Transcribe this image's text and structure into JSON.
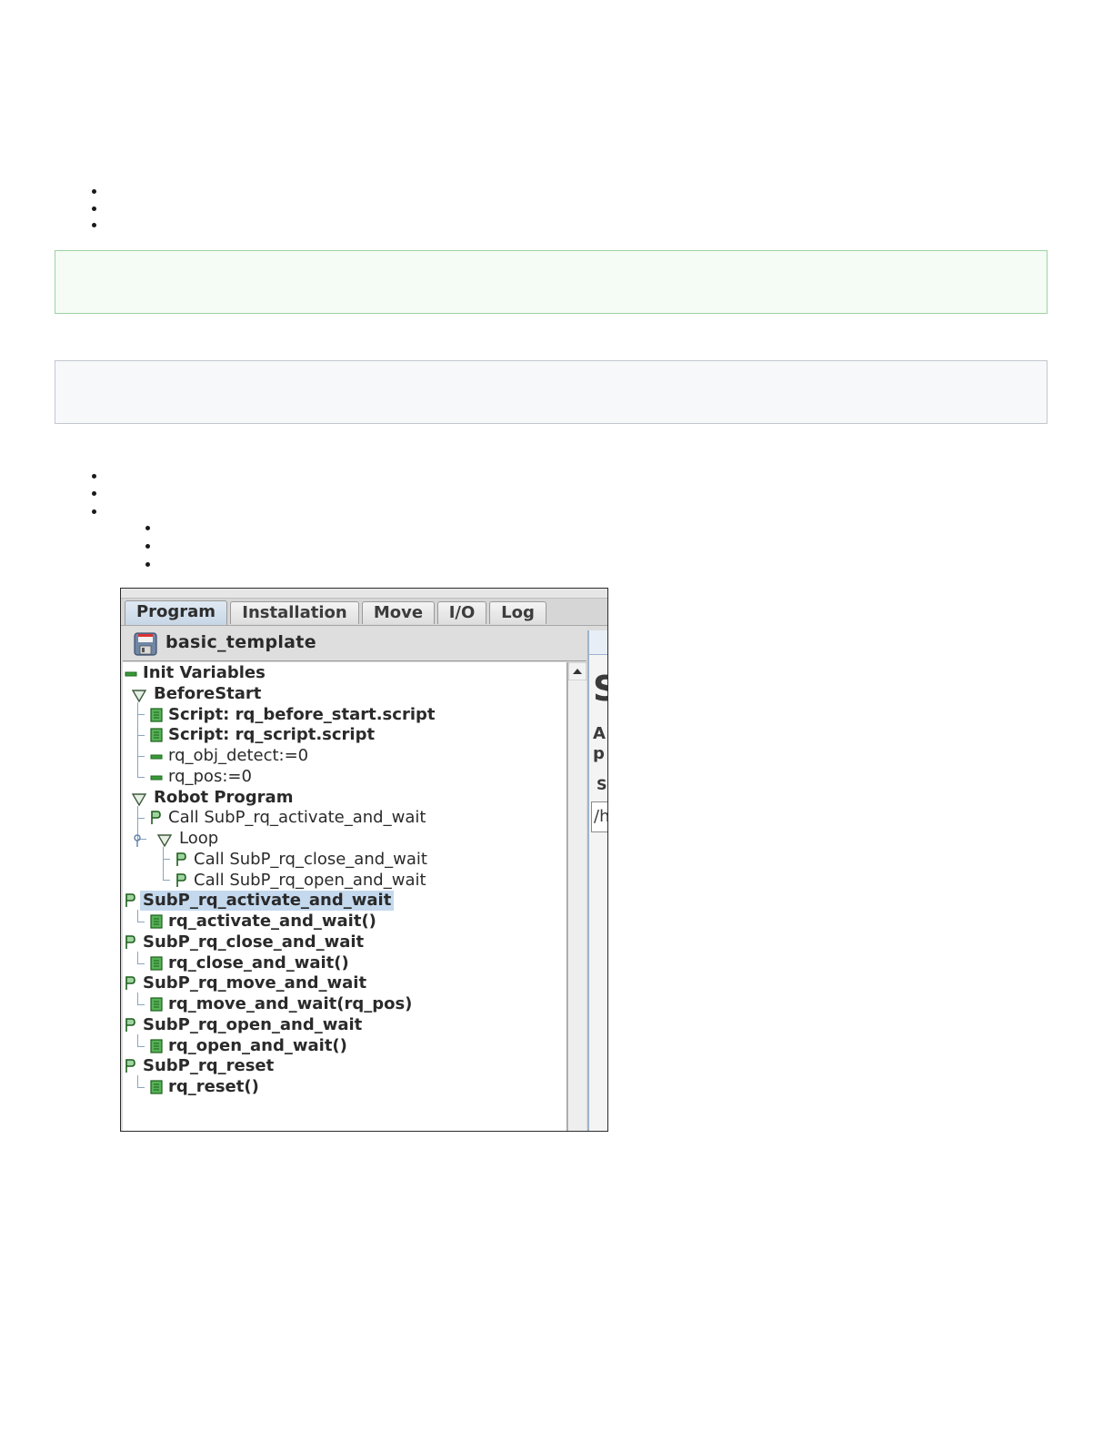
{
  "program_screenshot": {
    "tabs": [
      {
        "label": "Program",
        "active": true
      },
      {
        "label": "Installation",
        "active": false
      },
      {
        "label": "Move",
        "active": false
      },
      {
        "label": "I/O",
        "active": false
      },
      {
        "label": "Log",
        "active": false
      }
    ],
    "file_name": "basic_template",
    "tree": [
      {
        "label": "Init Variables",
        "icon": "variable-icon",
        "bold": true
      },
      {
        "label": "BeforeStart",
        "icon": "expand-triangle-icon",
        "bold": true
      },
      {
        "label": "Script: rq_before_start.script",
        "icon": "script-icon",
        "bold": true
      },
      {
        "label": "Script: rq_script.script",
        "icon": "script-icon",
        "bold": true
      },
      {
        "label": "rq_obj_detect:=0",
        "icon": "variable-icon",
        "bold": false
      },
      {
        "label": "rq_pos:=0",
        "icon": "variable-icon",
        "bold": false
      },
      {
        "label": "Robot Program",
        "icon": "expand-triangle-icon",
        "bold": true
      },
      {
        "label": "Call SubP_rq_activate_and_wait",
        "icon": "subprogram-icon",
        "bold": false
      },
      {
        "label": "Loop",
        "icon": "expand-triangle-icon",
        "bold": false
      },
      {
        "label": "Call SubP_rq_close_and_wait",
        "icon": "subprogram-icon",
        "bold": false
      },
      {
        "label": "Call SubP_rq_open_and_wait",
        "icon": "subprogram-icon",
        "bold": false
      },
      {
        "label": "SubP_rq_activate_and_wait",
        "icon": "subprogram-icon",
        "bold": true,
        "selected": true
      },
      {
        "label": "rq_activate_and_wait()",
        "icon": "script-icon",
        "bold": true
      },
      {
        "label": "SubP_rq_close_and_wait",
        "icon": "subprogram-icon",
        "bold": true
      },
      {
        "label": "rq_close_and_wait()",
        "icon": "script-icon",
        "bold": true
      },
      {
        "label": "SubP_rq_move_and_wait",
        "icon": "subprogram-icon",
        "bold": true
      },
      {
        "label": "rq_move_and_wait(rq_pos)",
        "icon": "script-icon",
        "bold": true
      },
      {
        "label": "SubP_rq_open_and_wait",
        "icon": "subprogram-icon",
        "bold": true
      },
      {
        "label": "rq_open_and_wait()",
        "icon": "script-icon",
        "bold": true
      },
      {
        "label": "SubP_rq_reset",
        "icon": "subprogram-icon",
        "bold": true
      },
      {
        "label": "rq_reset()",
        "icon": "script-icon",
        "bold": true
      }
    ],
    "right_panel_fragments": [
      "S",
      "A",
      "p",
      "S",
      "/h"
    ],
    "colors": {
      "selection": "#c5d9ee",
      "script_green": "#3f9a3f",
      "variable_green": "#2f8f2f",
      "note_green_border": "#9ed3a3",
      "note_gray_border": "#c2c8cf"
    }
  }
}
